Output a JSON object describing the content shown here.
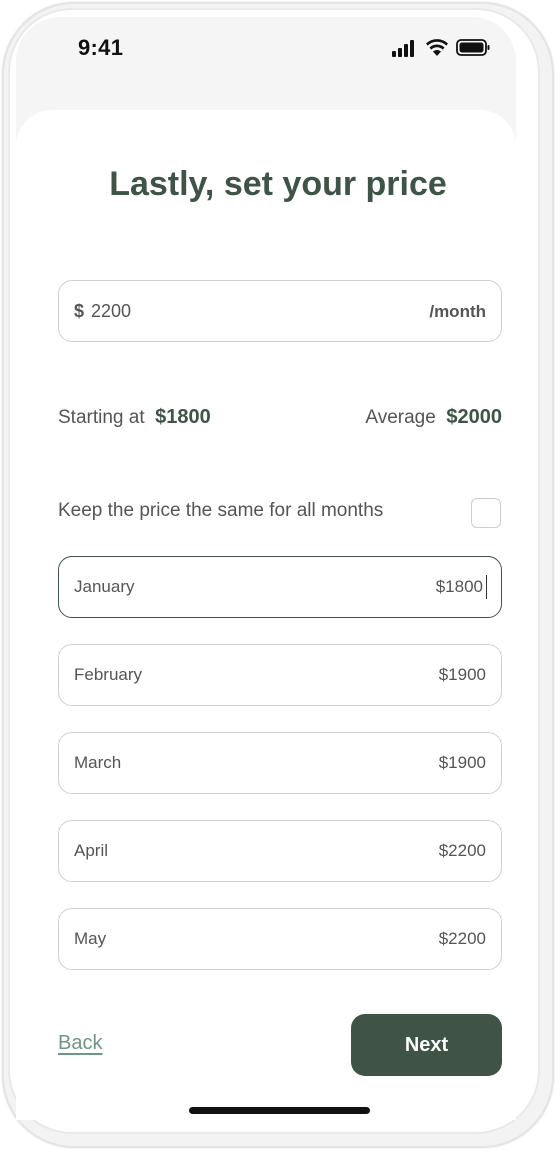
{
  "status_bar": {
    "time": "9:41",
    "signal_icon": "signal-icon",
    "wifi_icon": "wifi-icon",
    "battery_icon": "battery-icon"
  },
  "title": "Lastly, set your price",
  "price_input": {
    "currency": "$",
    "value": "2200",
    "suffix": "/month"
  },
  "stats": {
    "starting_label": "Starting at",
    "starting_value": "$1800",
    "average_label": "Average",
    "average_value": "$2000"
  },
  "same_price": {
    "label": "Keep the price the same for all months",
    "checked": false
  },
  "months": [
    {
      "label": "January",
      "price": "$1800",
      "active": true
    },
    {
      "label": "February",
      "price": "$1900",
      "active": false
    },
    {
      "label": "March",
      "price": "$1900",
      "active": false
    },
    {
      "label": "April",
      "price": "$2200",
      "active": false
    },
    {
      "label": "May",
      "price": "$2200",
      "active": false
    }
  ],
  "actions": {
    "back_label": "Back",
    "next_label": "Next"
  },
  "colors": {
    "primary": "#3f5346",
    "link": "#6f9684",
    "border": "#cdd3cf"
  }
}
